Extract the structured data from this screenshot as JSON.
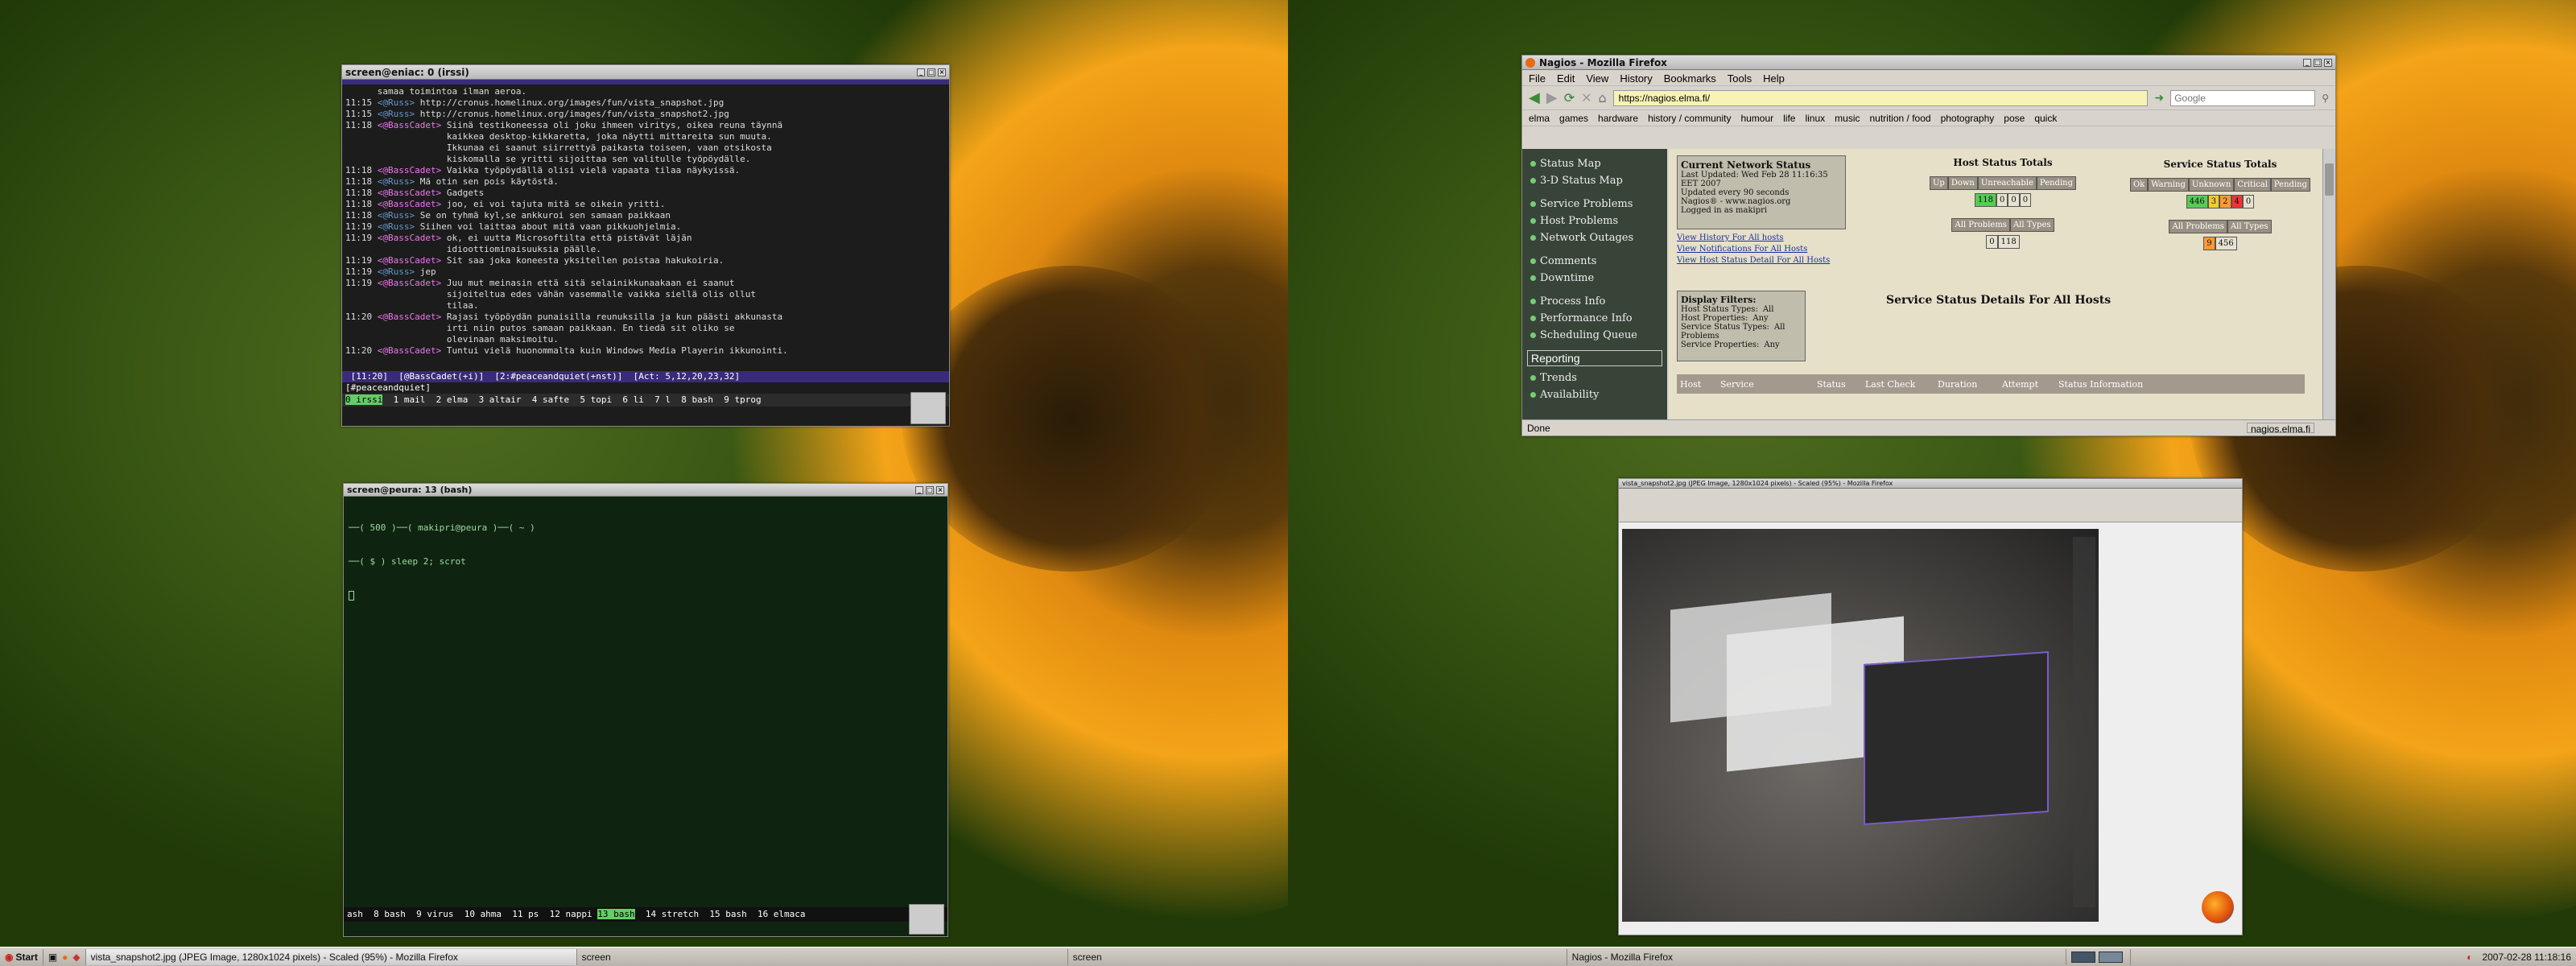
{
  "irssi": {
    "title": "screen@eniac: 0 (irssi)",
    "lines": [
      {
        "time": "",
        "nick": "",
        "text": "      samaa toimintoa ilman aeroa."
      },
      {
        "time": "11:15",
        "nick": "<@Russ>",
        "text": " http://cronus.homelinux.org/images/fun/vista_snapshot.jpg"
      },
      {
        "time": "11:15",
        "nick": "<@Russ>",
        "text": " http://cronus.homelinux.org/images/fun/vista_snapshot2.jpg"
      },
      {
        "time": "11:18",
        "nick": "<@BassCadet>",
        "text": " Siinä testikoneessa oli joku ihmeen viritys, oikea reuna täynnä"
      },
      {
        "time": "",
        "nick": "",
        "text": "                   kaikkea desktop-kikkaretta, joka näytti mittareita sun muuta."
      },
      {
        "time": "",
        "nick": "",
        "text": "                   Ikkunaa ei saanut siirrettyä paikasta toiseen, vaan otsikosta"
      },
      {
        "time": "",
        "nick": "",
        "text": "                   kiskomalla se yritti sijoittaa sen valitulle työpöydälle."
      },
      {
        "time": "11:18",
        "nick": "<@BassCadet>",
        "text": " Vaikka työpöydällä olisi vielä vapaata tilaa näykyissä."
      },
      {
        "time": "11:18",
        "nick": "<@Russ>",
        "text": " Mä otin sen pois käytöstä."
      },
      {
        "time": "11:18",
        "nick": "<@BassCadet>",
        "text": " Gadgets"
      },
      {
        "time": "11:18",
        "nick": "<@BassCadet>",
        "text": " joo, ei voi tajuta mitä se oikein yritti."
      },
      {
        "time": "11:18",
        "nick": "<@Russ>",
        "text": " Se on tyhmä kyl,se ankkuroi sen samaan paikkaan"
      },
      {
        "time": "11:19",
        "nick": "<@Russ>",
        "text": " Siihen voi laittaa about mitä vaan pikkuohjelmia."
      },
      {
        "time": "11:19",
        "nick": "<@BassCadet>",
        "text": " ok, ei uutta Microsoftilta että pistävät läjän"
      },
      {
        "time": "",
        "nick": "",
        "text": "                   idioottiominaisuuksia päälle."
      },
      {
        "time": "11:19",
        "nick": "<@BassCadet>",
        "text": " Sit saa joka koneesta yksitellen poistaa hakukoiria."
      },
      {
        "time": "11:19",
        "nick": "<@Russ>",
        "text": " jep"
      },
      {
        "time": "11:19",
        "nick": "<@BassCadet>",
        "text": " Juu mut meinasin että sitä selainikkunaakaan ei saanut"
      },
      {
        "time": "",
        "nick": "",
        "text": "                   sijoiteltua edes vähän vasemmalle vaikka siellä olis ollut"
      },
      {
        "time": "",
        "nick": "",
        "text": "                   tilaa."
      },
      {
        "time": "11:20",
        "nick": "<@BassCadet>",
        "text": " Rajasi työpöydän punaisilla reunuksilla ja kun päästi akkunasta"
      },
      {
        "time": "",
        "nick": "",
        "text": "                   irti niin putos samaan paikkaan. En tiedä sit oliko se"
      },
      {
        "time": "",
        "nick": "",
        "text": "                   olevinaan maksimoitu."
      },
      {
        "time": "11:20",
        "nick": "<@BassCadet>",
        "text": " Tuntui vielä huonommalta kuin Windows Media Playerin ikkunointi."
      }
    ],
    "status_bar": " [11:20]  [@BassCadet(+i)]  [2:#peaceandquiet(+nst)]  [Act: 5,12,20,23,32]",
    "input": "[#peaceandquiet] ",
    "screen_bar_hot": "0 irssi",
    "screen_bar": "  1 mail  2 elma  3 altair  4 safte  5 topi  6 li  7 l  8 bash  9 tprog"
  },
  "bash": {
    "title": "screen@peura: 13 (bash)",
    "lines": [
      "──( 500 )──( makipri@peura )──( ~ )",
      "──( $ ) sleep 2; scrot"
    ],
    "screen_bar_pre": "ash  8 bash  9 virus  10 ahma  11 ps  12 nappi ",
    "screen_bar_hot": "13 bash",
    "screen_bar_post": "  14 stretch  15 bash  16 elmaca"
  },
  "firefox": {
    "title": "Nagios - Mozilla Firefox",
    "menu": [
      "File",
      "Edit",
      "View",
      "History",
      "Bookmarks",
      "Tools",
      "Help"
    ],
    "url": "https://nagios.elma.fi/",
    "search_placeholder": "Google",
    "bookmarks": [
      "elma",
      "games",
      "hardware",
      "history / community",
      "humour",
      "life",
      "linux",
      "music",
      "nutrition / food",
      "photography",
      "pose",
      "quick"
    ],
    "status": "Done",
    "status_host": "nagios.elma.fi",
    "sidebar": [
      "Status Map",
      "3-D Status Map",
      "Service Problems",
      "Host Problems",
      "Network Outages",
      "Comments",
      "Downtime",
      "Process Info",
      "Performance Info",
      "Scheduling Queue"
    ],
    "reporting": "Reporting",
    "sidebar2": [
      "Trends",
      "Availability"
    ],
    "cns_title": "Current Network Status",
    "cns_lines": [
      "Last Updated: Wed Feb 28 11:16:35 EET 2007",
      "Updated every 90 seconds",
      "Nagios® - www.nagios.org",
      "Logged in as makipri"
    ],
    "cns_links": [
      "View History For All hosts",
      "View Notifications For All Hosts",
      "View Host Status Detail For All Hosts"
    ],
    "hst_title": "Host Status Totals",
    "hst_heads": [
      "Up",
      "Down",
      "Unreachable",
      "Pending"
    ],
    "hst_vals": [
      "118",
      "0",
      "0",
      "0"
    ],
    "hst_all_heads": [
      "All Problems",
      "All Types"
    ],
    "hst_all_vals": [
      "0",
      "118"
    ],
    "sst_title": "Service Status Totals",
    "sst_heads": [
      "Ok",
      "Warning",
      "Unknown",
      "Critical",
      "Pending"
    ],
    "sst_vals": [
      "446",
      "3",
      "2",
      "4",
      "0"
    ],
    "sst_all_heads": [
      "All Problems",
      "All Types"
    ],
    "sst_all_vals": [
      "9",
      "456"
    ],
    "filters_title": "Display Filters:",
    "filters": [
      [
        "Host Status Types:",
        "All"
      ],
      [
        "Host Properties:",
        "Any"
      ],
      [
        "Service Status Types:",
        "All Problems"
      ],
      [
        "Service Properties:",
        "Any"
      ]
    ],
    "details_title": "Service Status Details For All Hosts",
    "table_heads": [
      "Host",
      "Service",
      "Status",
      "Last Check",
      "Duration",
      "Attempt",
      "Status Information"
    ]
  },
  "viewer": {
    "title": "vista_snapshot2.jpg (JPEG Image, 1280x1024 pixels) - Scaled (95%) - Mozilla Firefox"
  },
  "taskbar": {
    "start": "Start",
    "tasks_left": [
      "vista_snapshot2.jpg (JPEG Image, 1280x1024 pixels) - Scaled (95%) - Mozilla Firefox",
      "screen"
    ],
    "tasks_right": [
      "screen",
      "Nagios - Mozilla Firefox"
    ],
    "clock": "2007-02-28 11:18:16"
  },
  "colors": {
    "irssi_bg": "#1c1c1c",
    "bash_bg": "#0e2410",
    "nagios_side": "#1d2a1d",
    "firefox_chrome": "#d8d4cc"
  }
}
